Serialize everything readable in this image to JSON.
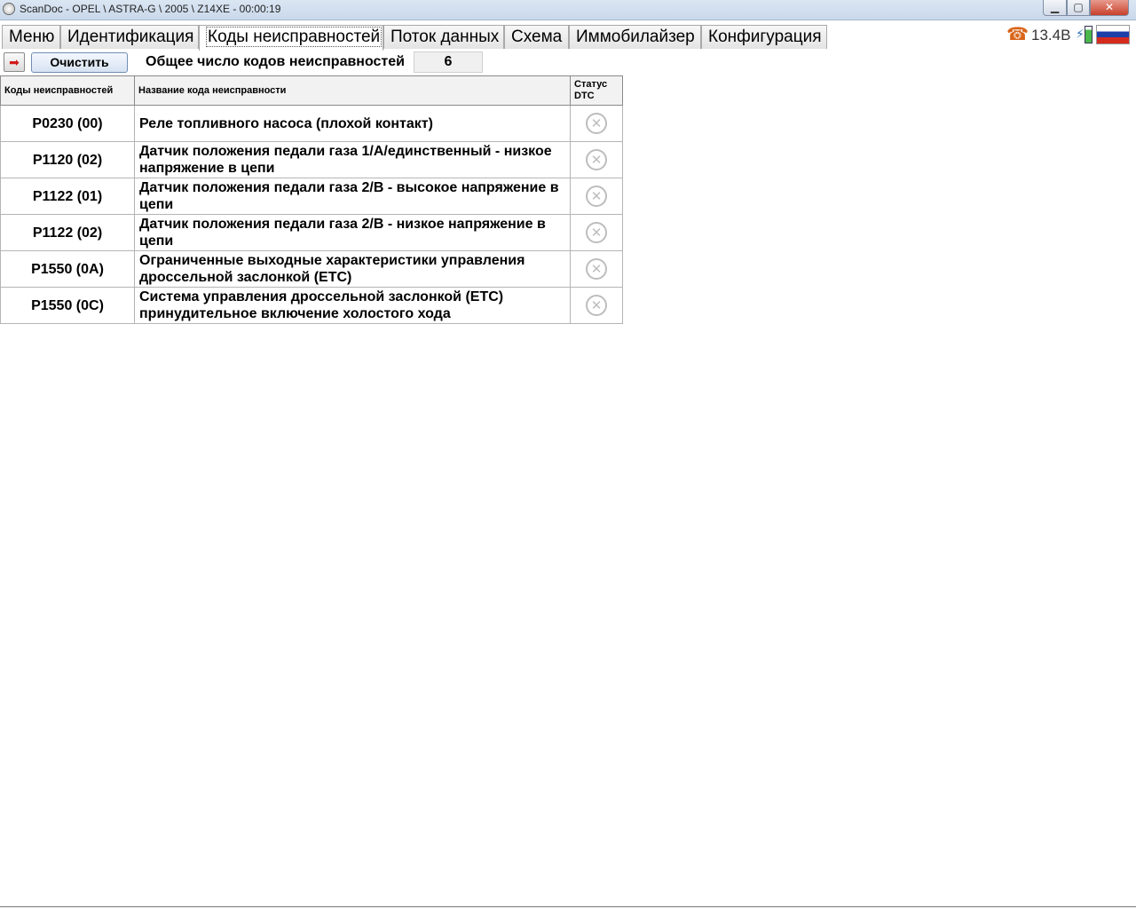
{
  "window": {
    "title": "ScanDoc - OPEL \\ ASTRA-G \\ 2005 \\ Z14XE - 00:00:19",
    "minimize_glyph": "▁",
    "maximize_glyph": "▢",
    "close_glyph": "✕"
  },
  "tabs": [
    {
      "label": "Меню",
      "active": false
    },
    {
      "label": "Идентификация",
      "active": false
    },
    {
      "label": "Коды неисправностей",
      "active": true
    },
    {
      "label": "Поток данных",
      "active": false
    },
    {
      "label": "Схема",
      "active": false
    },
    {
      "label": "Иммобилайзер",
      "active": false
    },
    {
      "label": "Конфигурация",
      "active": false
    }
  ],
  "status": {
    "voltage": "13.4B",
    "phone_icon": "phone-icon",
    "battery_icon": "battery-icon",
    "flag_icon": "russia-flag-icon"
  },
  "toolbar": {
    "clear_label": "Очистить",
    "total_label": "Общее число кодов неисправностей",
    "total_value": "6"
  },
  "table": {
    "headers": {
      "code": "Коды неисправностей",
      "name": "Название кода неисправности",
      "status": "Статус DTC"
    },
    "rows": [
      {
        "code": "P0230 (00)",
        "name": "Реле топливного насоса (плохой контакт)"
      },
      {
        "code": "P1120 (02)",
        "name": "Датчик положения педали газа 1/А/единственный - низкое напряжение в цепи"
      },
      {
        "code": "P1122 (01)",
        "name": "Датчик положения педали газа 2/В - высокое напряжение в цепи"
      },
      {
        "code": "P1122 (02)",
        "name": "Датчик положения педали газа 2/В - низкое напряжение в цепи"
      },
      {
        "code": "P1550 (0A)",
        "name": "Ограниченные выходные характеристики управления дроссельной заслонкой (ETC)"
      },
      {
        "code": "P1550 (0C)",
        "name": "Система управления дроссельной заслонкой (ETC) принудительное включение холостого хода"
      }
    ]
  },
  "colors": {
    "accent_border": "#6f8db4",
    "status_icon": "#bdbdbd",
    "phone": "#d9651a"
  }
}
